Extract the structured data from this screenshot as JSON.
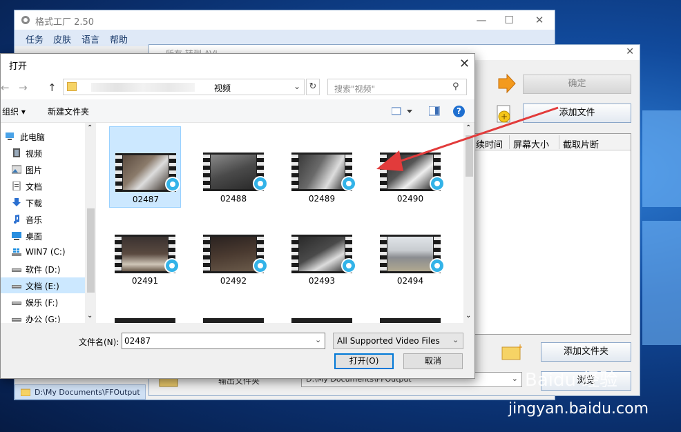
{
  "colors": {
    "accent": "#0078d7",
    "selection": "#cce8ff",
    "arrow": "#e23b3b"
  },
  "main_window": {
    "title": "格式工厂 2.50",
    "menu": [
      "任务",
      "皮肤",
      "语言",
      "帮助"
    ],
    "status_path": "D:\\My Documents\\FFOutput"
  },
  "convert_dialog": {
    "title": "所有 转到 AVI",
    "ok_label": "确定",
    "add_file_label": "添加文件",
    "columns": [
      "续时间",
      "屏幕大小",
      "截取片断"
    ],
    "add_folder_label": "添加文件夹",
    "browse_label": "浏览",
    "output_label": "输出文件夹",
    "output_path": "D:\\My Documents\\FFOutput"
  },
  "open_dialog": {
    "title": "打开",
    "address_current": "视频",
    "search_placeholder": "搜索\"视频\"",
    "toolbar": {
      "organize": "组织 ▾",
      "new_folder": "新建文件夹",
      "help": "?"
    },
    "sidebar": [
      {
        "label": "此电脑",
        "icon": "computer-icon"
      },
      {
        "label": "视频",
        "icon": "video-folder-icon"
      },
      {
        "label": "图片",
        "icon": "pictures-folder-icon"
      },
      {
        "label": "文档",
        "icon": "documents-folder-icon"
      },
      {
        "label": "下载",
        "icon": "download-icon"
      },
      {
        "label": "音乐",
        "icon": "music-icon"
      },
      {
        "label": "桌面",
        "icon": "desktop-icon"
      },
      {
        "label": "WIN7 (C:)",
        "icon": "windows-drive-icon"
      },
      {
        "label": "软件 (D:)",
        "icon": "drive-icon"
      },
      {
        "label": "文档 (E:)",
        "icon": "drive-icon"
      },
      {
        "label": "娱乐 (F:)",
        "icon": "drive-icon"
      },
      {
        "label": "办公 (G:)",
        "icon": "drive-icon"
      }
    ],
    "files": [
      "02487",
      "02488",
      "02489",
      "02490",
      "02491",
      "02492",
      "02493",
      "02494"
    ],
    "filename_label": "文件名(N):",
    "filename_value": "02487",
    "filetype_value": "All Supported Video Files",
    "open_label": "打开(O)",
    "cancel_label": "取消"
  },
  "watermark": {
    "site": "jingyan.baidu.com",
    "brand": "Baidu 经验"
  }
}
